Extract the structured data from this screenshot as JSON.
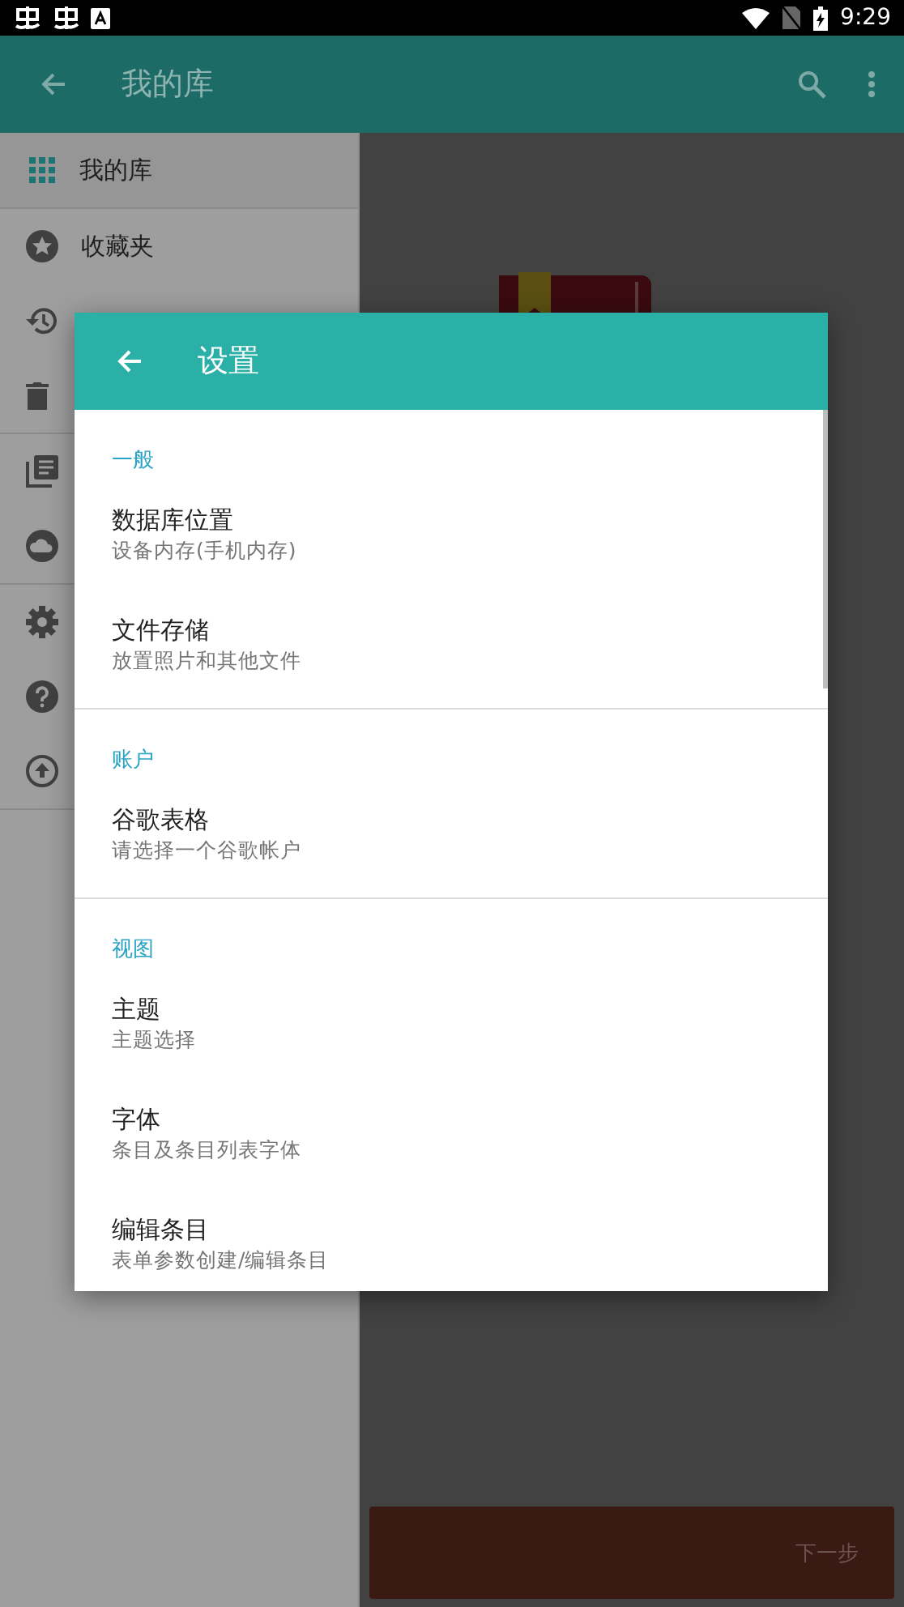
{
  "status_bar": {
    "time": "9:29"
  },
  "app_bar": {
    "title": "我的库"
  },
  "sidebar": {
    "groups": [
      [
        {
          "label": "我的库",
          "kind": "grid",
          "selected": true
        }
      ],
      [
        {
          "label": "收藏夹",
          "kind": "star",
          "selected": false
        },
        {
          "kind": "history",
          "selected": false
        },
        {
          "kind": "trash",
          "selected": false
        }
      ],
      [
        {
          "kind": "library",
          "selected": false
        },
        {
          "kind": "cloud",
          "selected": false
        }
      ],
      [
        {
          "kind": "settings",
          "selected": false
        },
        {
          "kind": "help",
          "selected": false
        },
        {
          "kind": "upload",
          "selected": false
        }
      ]
    ]
  },
  "next_button": {
    "label": "下一步"
  },
  "dialog": {
    "title": "设置",
    "sections": [
      {
        "header": "一般",
        "items": [
          {
            "title": "数据库位置",
            "subtitle": "设备内存(手机内存)"
          },
          {
            "title": "文件存储",
            "subtitle": "放置照片和其他文件"
          }
        ]
      },
      {
        "header": "账户",
        "items": [
          {
            "title": "谷歌表格",
            "subtitle": "请选择一个谷歌帐户"
          }
        ]
      },
      {
        "header": "视图",
        "items": [
          {
            "title": "主题",
            "subtitle": "主题选择"
          },
          {
            "title": "字体",
            "subtitle": "条目及条目列表字体"
          },
          {
            "title": "编辑条目",
            "subtitle": "表单参数创建/编辑条目"
          }
        ]
      }
    ]
  }
}
